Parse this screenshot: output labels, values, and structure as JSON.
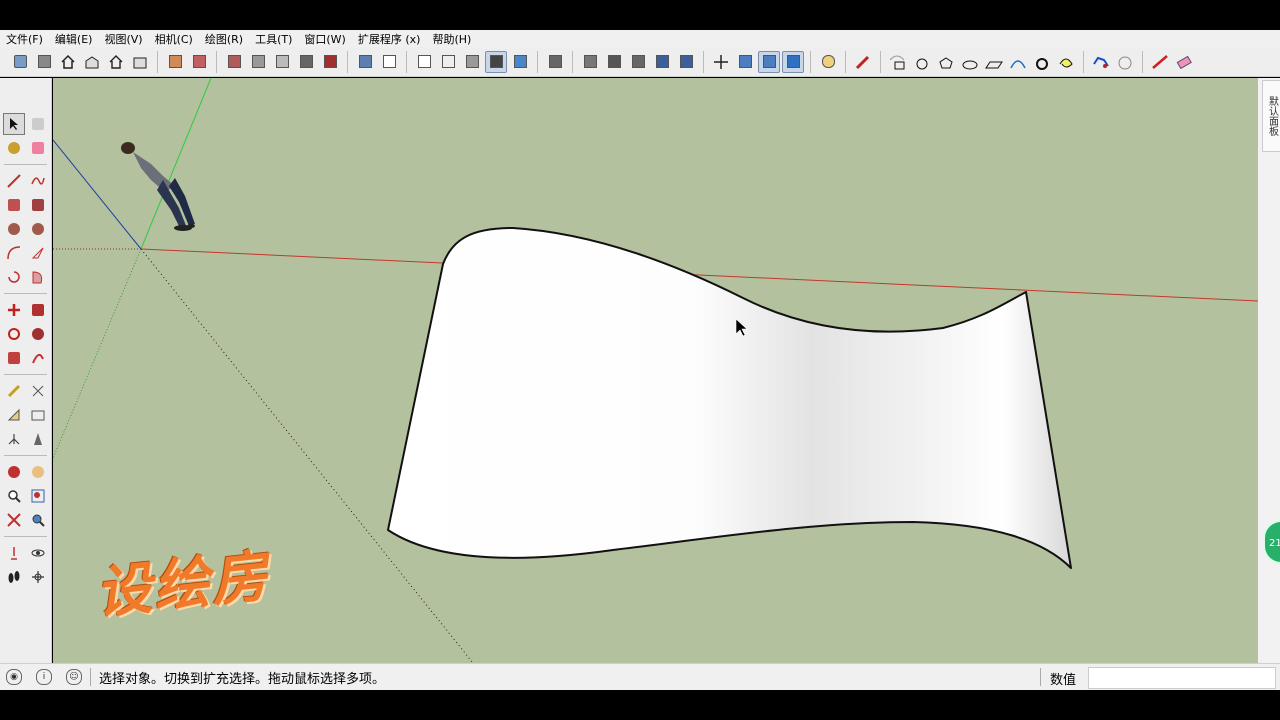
{
  "menu": {
    "items": [
      "文件(F)",
      "编辑(E)",
      "视图(V)",
      "相机(C)",
      "绘图(R)",
      "工具(T)",
      "窗口(W)",
      "扩展程序 (x)",
      "帮助(H)"
    ]
  },
  "tray": {
    "tab_label": "默认面板"
  },
  "badge": {
    "text": "21"
  },
  "status": {
    "message": "选择对象。切换到扩充选择。拖动鼠标选择多项。",
    "measure_label": "数值",
    "measure_value": ""
  },
  "watermark": {
    "text": "设绘房"
  },
  "icons": {
    "toolbar": [
      "getting-started-icon",
      "warehouse-icon",
      "home-icon",
      "front-view-icon",
      "top-view-icon",
      "back-view-icon",
      "push-pull-icon",
      "section-icon",
      "box-icon",
      "cylinder-icon",
      "cone-icon",
      "sphere-icon",
      "solid-tools-icon",
      "xray-icon",
      "wireframe-icon",
      "hidden-line-icon",
      "shaded-icon",
      "shaded-texture-icon",
      "monochrome-icon",
      "layer-icon",
      "components-icon",
      "materials-icon",
      "styles-icon",
      "shadows-icon",
      "orbit-icon",
      "pan-icon",
      "zoom-icon",
      "zoom-extents-icon",
      "tag-icon",
      "pencil-icon",
      "draw-rect-icon",
      "draw-circle-icon",
      "draw-polygon-icon",
      "draw-ellipse-icon",
      "draw-parallelogram-icon",
      "draw-arc-icon",
      "draw-donut-icon",
      "draw-spiral-icon",
      "draw-freeform-icon",
      "draw-cloud-icon",
      "line-red-icon",
      "eraser-pink-icon"
    ],
    "left": [
      "select-icon",
      "component-icon",
      "paint-icon",
      "eraser-icon",
      "line-icon",
      "freehand-icon",
      "rectangle-icon",
      "rotated-rect-icon",
      "circle-icon",
      "polygon-icon",
      "arc-icon",
      "pie-icon",
      "arc3-icon",
      "arc2-icon",
      "move-icon",
      "push-pull-icon",
      "rotate-icon",
      "follow-me-icon",
      "scale-icon",
      "offset-icon",
      "tape-icon",
      "dimension-icon",
      "protractor-icon",
      "text-icon",
      "axes-icon",
      "3d-text-icon",
      "orbit-icon",
      "pan-icon",
      "zoom-icon",
      "zoom-window-icon",
      "zoom-extents-icon",
      "previous-icon",
      "position-camera-icon",
      "look-around-icon",
      "walk-icon",
      "section-plane-icon"
    ]
  },
  "colors": {
    "viewport_bg": "#b3c19e",
    "red_axis": "#c0392b",
    "green_axis": "#2ecc40",
    "blue_axis": "#2040a0"
  }
}
